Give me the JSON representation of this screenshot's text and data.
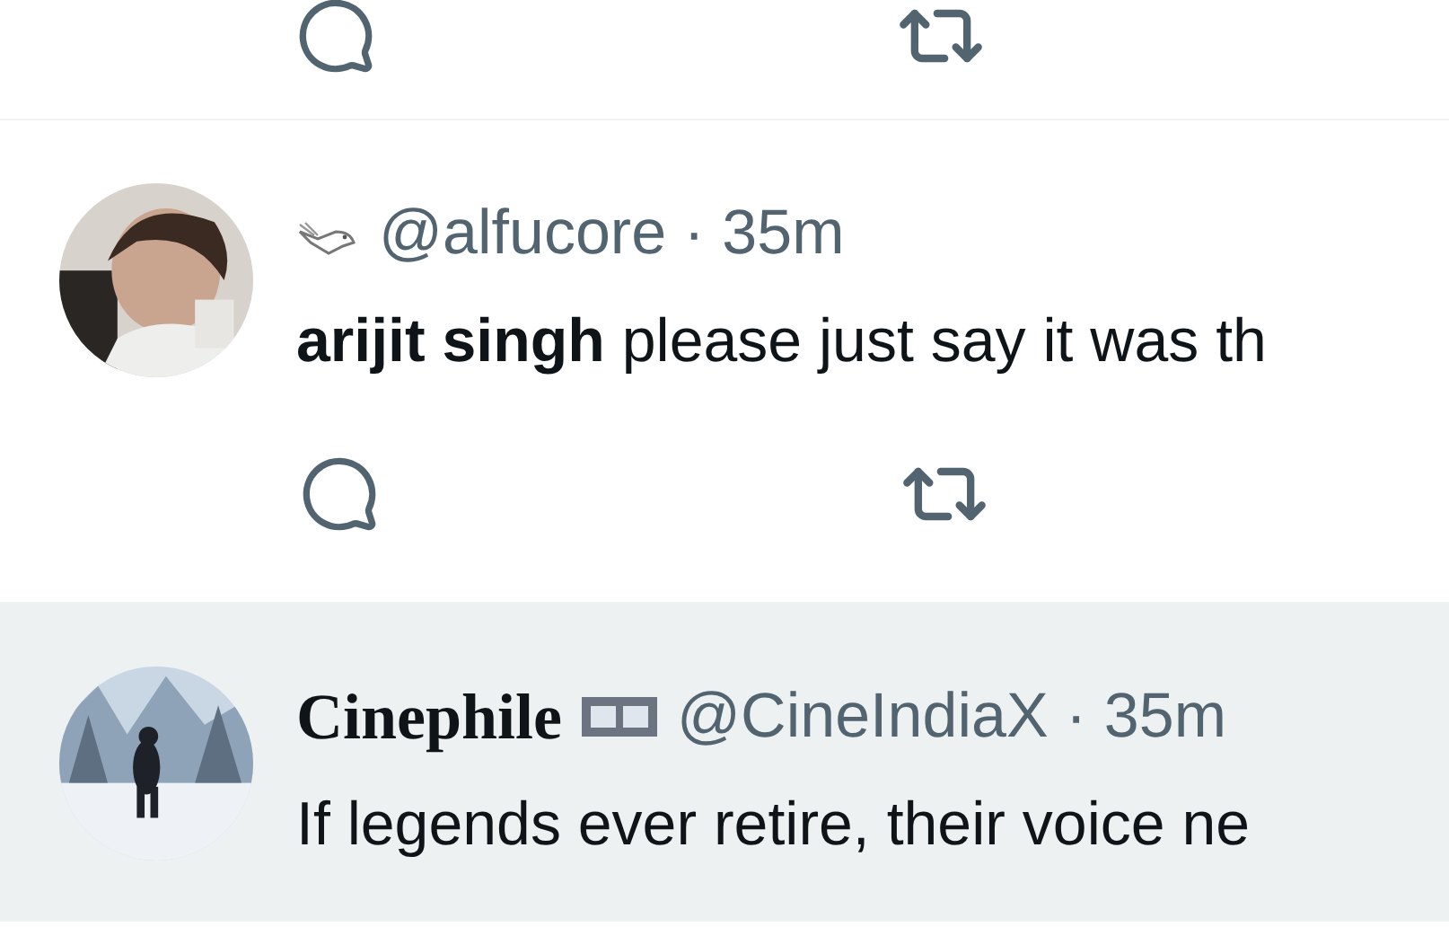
{
  "tweets": [
    {
      "handle": "@alfucore",
      "separator": "·",
      "time": "35m",
      "body": "**arijit singh** please just say it was th",
      "highlighted": false
    },
    {
      "name": "Cinephile",
      "handle": "@CineIndiaX",
      "separator": "·",
      "time": "35m",
      "body": "If legends ever retire, their voice ne",
      "highlighted": true
    }
  ]
}
